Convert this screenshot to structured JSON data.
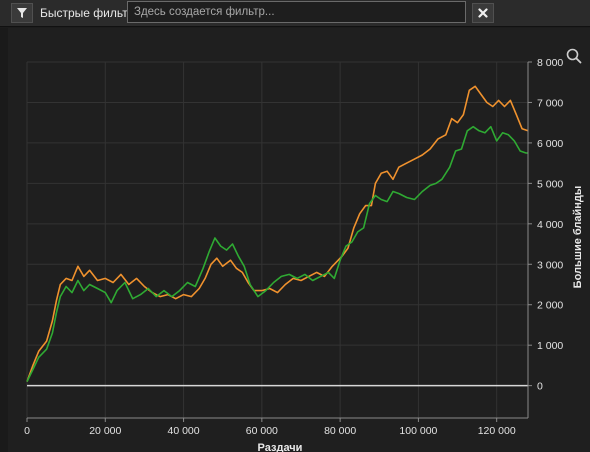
{
  "toolbar": {
    "filter_label": "Быстрые фильтры",
    "filter_placeholder": "Здесь создается фильтр...",
    "filter_icon": "filter-icon",
    "clear_icon": "close-icon",
    "zoom_icon": "search-icon"
  },
  "chart_data": {
    "type": "line",
    "xlabel": "Раздачи",
    "ylabel": "Большие блайнды",
    "x_ticks": [
      "0",
      "20 000",
      "40 000",
      "60 000",
      "80 000",
      "100 000",
      "120 000"
    ],
    "y_ticks": [
      "0",
      "1 000",
      "2 000",
      "3 000",
      "4 000",
      "5 000",
      "6 000",
      "7 000",
      "8 000"
    ],
    "xlim": [
      0,
      128000
    ],
    "ylim": [
      -800,
      8000
    ],
    "grid": true,
    "zero_line": true,
    "series": [
      {
        "color": "#f0922e",
        "points": [
          [
            0,
            100
          ],
          [
            1500,
            500
          ],
          [
            3000,
            850
          ],
          [
            5000,
            1100
          ],
          [
            6500,
            1600
          ],
          [
            7500,
            2100
          ],
          [
            8500,
            2500
          ],
          [
            10000,
            2650
          ],
          [
            11500,
            2600
          ],
          [
            13000,
            2950
          ],
          [
            14500,
            2700
          ],
          [
            16000,
            2850
          ],
          [
            18000,
            2600
          ],
          [
            20000,
            2650
          ],
          [
            22000,
            2550
          ],
          [
            24000,
            2750
          ],
          [
            26000,
            2500
          ],
          [
            28000,
            2650
          ],
          [
            30000,
            2450
          ],
          [
            32000,
            2300
          ],
          [
            34000,
            2200
          ],
          [
            36000,
            2250
          ],
          [
            38000,
            2150
          ],
          [
            40000,
            2250
          ],
          [
            42000,
            2200
          ],
          [
            44000,
            2400
          ],
          [
            45500,
            2650
          ],
          [
            47000,
            3000
          ],
          [
            48500,
            3150
          ],
          [
            50000,
            2950
          ],
          [
            52000,
            3100
          ],
          [
            53500,
            2900
          ],
          [
            55000,
            2800
          ],
          [
            56500,
            2550
          ],
          [
            58000,
            2350
          ],
          [
            60000,
            2350
          ],
          [
            62000,
            2400
          ],
          [
            64000,
            2300
          ],
          [
            66000,
            2500
          ],
          [
            68000,
            2650
          ],
          [
            70000,
            2600
          ],
          [
            72000,
            2700
          ],
          [
            74000,
            2800
          ],
          [
            76000,
            2700
          ],
          [
            78000,
            2950
          ],
          [
            79500,
            3100
          ],
          [
            80500,
            3200
          ],
          [
            82000,
            3400
          ],
          [
            83500,
            3900
          ],
          [
            85000,
            4250
          ],
          [
            86500,
            4450
          ],
          [
            88000,
            4450
          ],
          [
            89000,
            5000
          ],
          [
            90500,
            5250
          ],
          [
            92000,
            5300
          ],
          [
            93500,
            5100
          ],
          [
            95000,
            5400
          ],
          [
            97000,
            5500
          ],
          [
            99000,
            5600
          ],
          [
            101000,
            5700
          ],
          [
            103000,
            5850
          ],
          [
            105000,
            6100
          ],
          [
            107000,
            6200
          ],
          [
            108500,
            6600
          ],
          [
            110000,
            6500
          ],
          [
            111500,
            6700
          ],
          [
            113000,
            7300
          ],
          [
            114500,
            7400
          ],
          [
            116000,
            7200
          ],
          [
            117500,
            7000
          ],
          [
            119000,
            6900
          ],
          [
            120500,
            7050
          ],
          [
            122000,
            6900
          ],
          [
            123500,
            7050
          ],
          [
            125000,
            6700
          ],
          [
            126500,
            6350
          ],
          [
            128000,
            6300
          ]
        ]
      },
      {
        "color": "#2faa33",
        "points": [
          [
            0,
            100
          ],
          [
            1500,
            400
          ],
          [
            3000,
            700
          ],
          [
            5000,
            900
          ],
          [
            6500,
            1300
          ],
          [
            7500,
            1800
          ],
          [
            8500,
            2200
          ],
          [
            10000,
            2450
          ],
          [
            11500,
            2300
          ],
          [
            13000,
            2600
          ],
          [
            14500,
            2350
          ],
          [
            16000,
            2500
          ],
          [
            18000,
            2400
          ],
          [
            20000,
            2300
          ],
          [
            21500,
            2050
          ],
          [
            23000,
            2350
          ],
          [
            25000,
            2550
          ],
          [
            27000,
            2150
          ],
          [
            29000,
            2250
          ],
          [
            31000,
            2400
          ],
          [
            33000,
            2200
          ],
          [
            35000,
            2350
          ],
          [
            37000,
            2200
          ],
          [
            39000,
            2350
          ],
          [
            41000,
            2550
          ],
          [
            43000,
            2450
          ],
          [
            45000,
            2900
          ],
          [
            46500,
            3300
          ],
          [
            48000,
            3650
          ],
          [
            49500,
            3450
          ],
          [
            51000,
            3350
          ],
          [
            52500,
            3500
          ],
          [
            54000,
            3200
          ],
          [
            55500,
            2950
          ],
          [
            57000,
            2500
          ],
          [
            59000,
            2200
          ],
          [
            61000,
            2350
          ],
          [
            63000,
            2550
          ],
          [
            65000,
            2700
          ],
          [
            67000,
            2750
          ],
          [
            69000,
            2650
          ],
          [
            71000,
            2750
          ],
          [
            73000,
            2600
          ],
          [
            75000,
            2700
          ],
          [
            77000,
            2800
          ],
          [
            78500,
            2650
          ],
          [
            80000,
            3100
          ],
          [
            81500,
            3450
          ],
          [
            83000,
            3550
          ],
          [
            84500,
            3800
          ],
          [
            86000,
            3900
          ],
          [
            87500,
            4500
          ],
          [
            89000,
            4700
          ],
          [
            90500,
            4600
          ],
          [
            92000,
            4550
          ],
          [
            93500,
            4800
          ],
          [
            95000,
            4750
          ],
          [
            97000,
            4650
          ],
          [
            99000,
            4600
          ],
          [
            101000,
            4800
          ],
          [
            103000,
            4950
          ],
          [
            104500,
            5000
          ],
          [
            106000,
            5100
          ],
          [
            108000,
            5400
          ],
          [
            109500,
            5800
          ],
          [
            111000,
            5850
          ],
          [
            112500,
            6300
          ],
          [
            114000,
            6400
          ],
          [
            115500,
            6300
          ],
          [
            117000,
            6250
          ],
          [
            118500,
            6400
          ],
          [
            120000,
            6050
          ],
          [
            121500,
            6250
          ],
          [
            123000,
            6200
          ],
          [
            124500,
            6050
          ],
          [
            126000,
            5800
          ],
          [
            127500,
            5750
          ],
          [
            128000,
            5750
          ]
        ]
      }
    ]
  }
}
